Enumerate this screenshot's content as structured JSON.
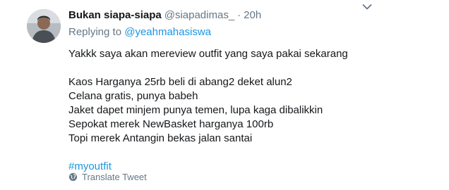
{
  "tweet": {
    "display_name": "Bukan siapa-siapa",
    "handle": "@siapadimas_",
    "separator": "·",
    "time": "20h",
    "reply_prefix": "Replying to",
    "reply_to": "@yeahmahasiswa",
    "lines": [
      "Yakkk saya akan mereview outfit yang saya pakai sekarang",
      "Kaos Harganya 25rb beli di abang2 deket alun2",
      "Celana gratis, punya babeh",
      "Jaket dapet minjem punya temen, lupa kaga dibalikkin",
      "Sepokat merek NewBasket harganya 100rb",
      "Topi merek Antangin bekas jalan santai"
    ],
    "hashtag": "#myoutfit",
    "translate_label": "Translate Tweet"
  },
  "icons": {
    "avatar": "avatar",
    "caret": "chevron-down-icon",
    "globe": "globe-icon"
  },
  "colors": {
    "link": "#1b95e0",
    "muted": "#657786",
    "text": "#14171a"
  }
}
